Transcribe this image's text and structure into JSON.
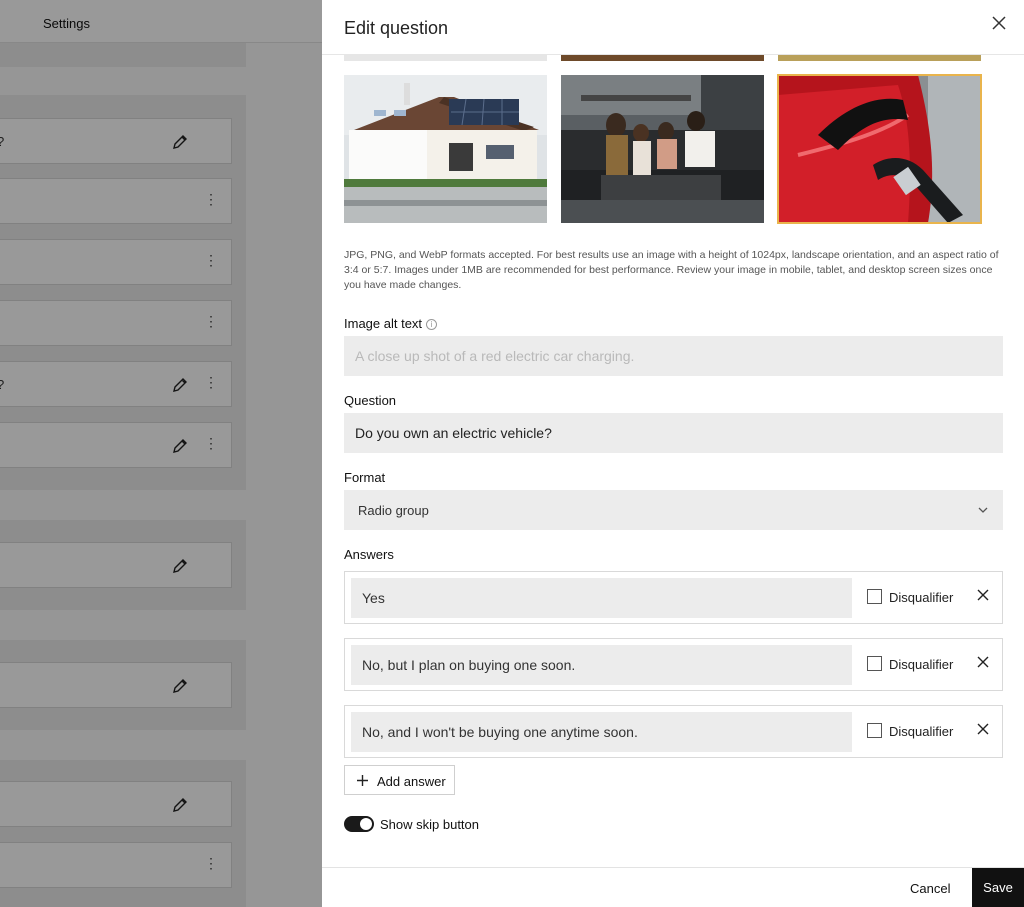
{
  "background": {
    "tab_label": "Settings",
    "rows": [
      {
        "text": "?"
      },
      {
        "text": ""
      },
      {
        "text": ""
      },
      {
        "text": ""
      },
      {
        "text": "?"
      },
      {
        "text": ""
      },
      {
        "text": ""
      },
      {
        "text": ""
      },
      {
        "text": ""
      },
      {
        "text": ""
      }
    ]
  },
  "drawer": {
    "title": "Edit question",
    "images": [
      {
        "icon": "house-solar-panels-image",
        "alt": "House with solar panels"
      },
      {
        "icon": "family-on-couch-image",
        "alt": "Family on couch"
      },
      {
        "icon": "electric-car-charging-image",
        "alt": "Red electric car charging"
      }
    ],
    "help_text": "JPG, PNG, and WebP formats accepted. For best results use an image with a height of 1024px, landscape orientation, and an aspect ratio of 3:4 or 5:7. Images under 1MB are recommended for best performance. Review your image in mobile, tablet, and desktop screen sizes once you have made changes.",
    "alt_text": {
      "label": "Image alt text",
      "placeholder": "A close up shot of a red electric car charging.",
      "value": ""
    },
    "question": {
      "label": "Question",
      "value": "Do you own an electric vehicle?"
    },
    "format": {
      "label": "Format",
      "value": "Radio group"
    },
    "answers": {
      "label": "Answers",
      "disqualifier_label": "Disqualifier",
      "items": [
        {
          "value": "Yes",
          "disqualifier": false
        },
        {
          "value": "No, but I plan on buying one soon.",
          "disqualifier": false
        },
        {
          "value": "No, and I won't be buying one anytime soon.",
          "disqualifier": false
        }
      ]
    },
    "add_answer_label": "Add answer",
    "skip": {
      "label": "Show skip button",
      "enabled": true
    },
    "footer": {
      "cancel_label": "Cancel",
      "save_label": "Save"
    }
  },
  "colors": {
    "accent": "#111111",
    "selected_outline": "#e9b44c",
    "input_bg": "#ececec"
  }
}
